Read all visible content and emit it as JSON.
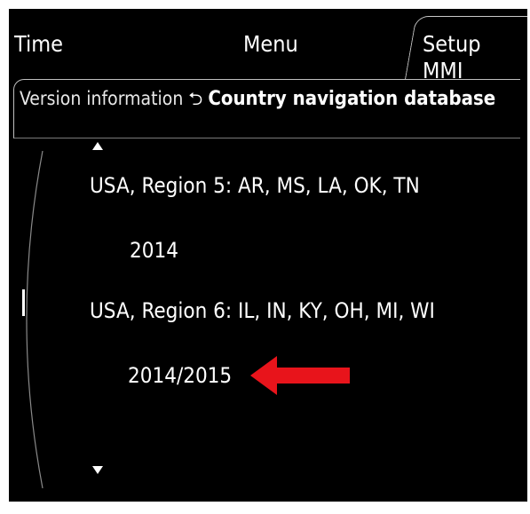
{
  "header": {
    "tabs": [
      {
        "label": "Time"
      },
      {
        "label": "Menu"
      },
      {
        "label": "Setup MMI"
      }
    ]
  },
  "breadcrumb": {
    "parent": "Version information",
    "current": "Country navigation database"
  },
  "list": {
    "items": [
      {
        "name": "USA, Region  5: AR, MS, LA, OK, TN",
        "version": "2014"
      },
      {
        "name": "USA, Region  6: IL, IN, KY, OH, MI, WI",
        "version": "2014/2015"
      }
    ]
  },
  "colors": {
    "background": "#000000",
    "text": "#ffffff",
    "annotation_arrow": "#e8141b"
  },
  "icons": [
    "return-icon",
    "scroll-up-icon",
    "scroll-down-icon",
    "red-arrow-icon"
  ]
}
